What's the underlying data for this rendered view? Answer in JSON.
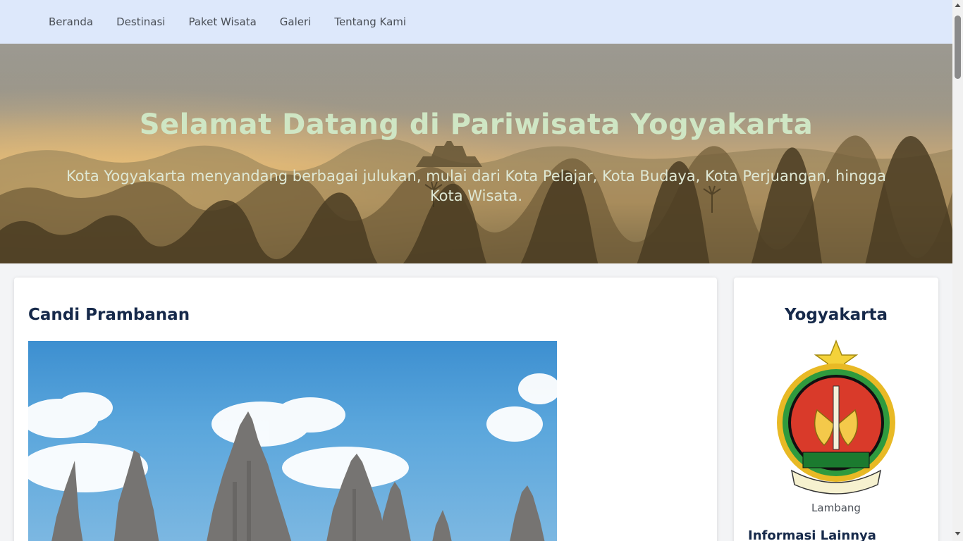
{
  "nav": {
    "items": [
      {
        "label": "Beranda"
      },
      {
        "label": "Destinasi"
      },
      {
        "label": "Paket Wisata"
      },
      {
        "label": "Galeri"
      },
      {
        "label": "Tentang Kami"
      }
    ]
  },
  "hero": {
    "title": "Selamat Datang di Pariwisata Yogyakarta",
    "subtitle": "Kota Yogyakarta menyandang berbagai julukan, mulai dari Kota Pelajar, Kota Budaya, Kota Perjuangan, hingga Kota Wisata."
  },
  "main": {
    "heading": "Candi Prambanan",
    "image_icon": "prambanan-temple-photo"
  },
  "sidebar": {
    "heading": "Yogyakarta",
    "emblem_icon": "yogyakarta-coat-of-arms",
    "emblem_caption": "Lambang",
    "more_heading": "Informasi Lainnya"
  },
  "colors": {
    "nav_bg": "#dde8fb",
    "heading": "#16294a",
    "hero_title": "#cfe6c4"
  }
}
